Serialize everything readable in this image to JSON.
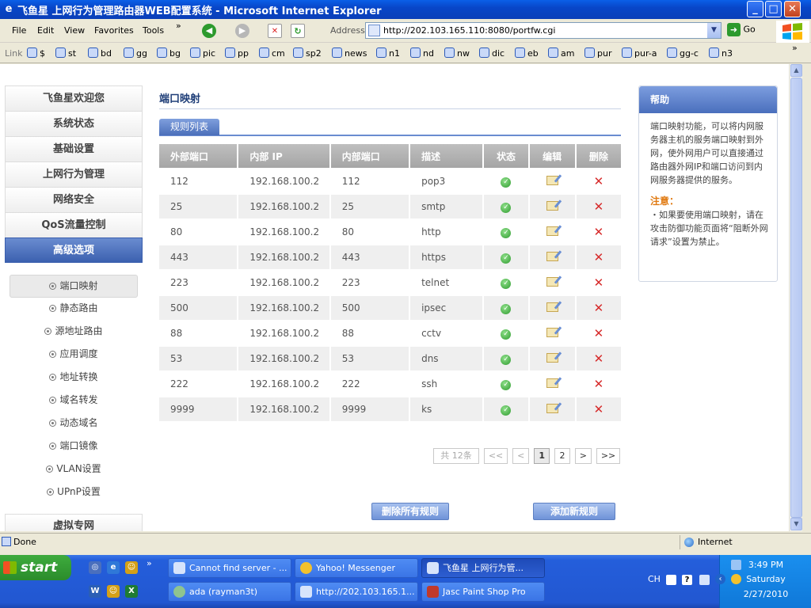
{
  "window": {
    "title": "飞鱼星 上网行为管理路由器WEB配置系统 - Microsoft Internet Explorer",
    "minimize_glyph": "_",
    "maximize_glyph": "□",
    "close_glyph": "✕"
  },
  "menubar": {
    "items": [
      "File",
      "Edit",
      "View",
      "Favorites",
      "Tools"
    ],
    "more": "»",
    "address_label": "Address",
    "address_value": "http://202.103.165.110:8080/portfw.cgi",
    "go_label": "Go"
  },
  "links_bar": {
    "label": "Link",
    "items": [
      "$",
      "st",
      "bd",
      "gg",
      "bg",
      "pic",
      "pp",
      "cm",
      "sp2",
      "news",
      "n1",
      "nd",
      "nw",
      "dic",
      "eb",
      "am",
      "pur",
      "pur-a",
      "gg-c",
      "n3"
    ],
    "more": "»"
  },
  "left_nav": {
    "items": [
      "飞鱼星欢迎您",
      "系统状态",
      "基础设置",
      "上网行为管理",
      "网络安全",
      "QoS流量控制",
      "高级选项"
    ],
    "active_index": 6,
    "sub_items": [
      "端口映射",
      "静态路由",
      "源地址路由",
      "应用调度",
      "地址转换",
      "域名转发",
      "动态域名",
      "端口镜像",
      "VLAN设置",
      "UPnP设置"
    ],
    "active_sub_index": 0,
    "bottom_item": "虚拟专网"
  },
  "main": {
    "page_title": "端口映射",
    "tab_label": "规则列表",
    "columns": [
      "外部端口",
      "内部 IP",
      "内部端口",
      "描述",
      "状态",
      "编辑",
      "删除"
    ],
    "rows": [
      {
        "ext_port": "112",
        "ip": "192.168.100.2",
        "int_port": "112",
        "desc": "pop3"
      },
      {
        "ext_port": "25",
        "ip": "192.168.100.2",
        "int_port": "25",
        "desc": "smtp"
      },
      {
        "ext_port": "80",
        "ip": "192.168.100.2",
        "int_port": "80",
        "desc": "http"
      },
      {
        "ext_port": "443",
        "ip": "192.168.100.2",
        "int_port": "443",
        "desc": "https"
      },
      {
        "ext_port": "223",
        "ip": "192.168.100.2",
        "int_port": "223",
        "desc": "telnet"
      },
      {
        "ext_port": "500",
        "ip": "192.168.100.2",
        "int_port": "500",
        "desc": "ipsec"
      },
      {
        "ext_port": "88",
        "ip": "192.168.100.2",
        "int_port": "88",
        "desc": "cctv"
      },
      {
        "ext_port": "53",
        "ip": "192.168.100.2",
        "int_port": "53",
        "desc": "dns"
      },
      {
        "ext_port": "222",
        "ip": "192.168.100.2",
        "int_port": "222",
        "desc": "ssh"
      },
      {
        "ext_port": "9999",
        "ip": "192.168.100.2",
        "int_port": "9999",
        "desc": "ks"
      }
    ],
    "pager": {
      "total": "共 12条",
      "first": "<<",
      "prev": "<",
      "pages": [
        "1",
        "2"
      ],
      "current": "1",
      "next": ">",
      "last": ">>"
    },
    "delete_all_label": "删除所有规则",
    "add_rule_label": "添加新规则"
  },
  "help": {
    "title": "帮助",
    "body": "端口映射功能，可以将内网服务器主机的服务端口映射到外网，使外网用户可以直接通过路由器外网IP和端口访问到内网服务器提供的服务。",
    "note_title": "注意：",
    "note_body": "・如果要使用端口映射，请在攻击防御功能页面将“阻断外网请求”设置为禁止。"
  },
  "statusbar": {
    "status": "Done",
    "zone": "Internet"
  },
  "taskbar": {
    "start_label": "start",
    "tasks": [
      "Cannot find server - ...",
      "Yahoo! Messenger",
      "飞鱼星 上网行为管...",
      "ada (rayman3t)",
      "http://202.103.165.1...",
      "Jasc Paint Shop Pro"
    ],
    "active_task_index": 2,
    "quick_launch_more": "»",
    "lang": "CH",
    "time": "3:49 PM",
    "day": "Saturday",
    "date": "2/27/2010"
  },
  "colors": {
    "accent": "#4a6fbd",
    "note": "#e07a12",
    "status_ok": "#2f9b2f",
    "delete": "#d62a2a"
  },
  "icons": {
    "status": "ok-check-icon",
    "edit": "edit-note-icon",
    "delete": "delete-x-icon"
  }
}
